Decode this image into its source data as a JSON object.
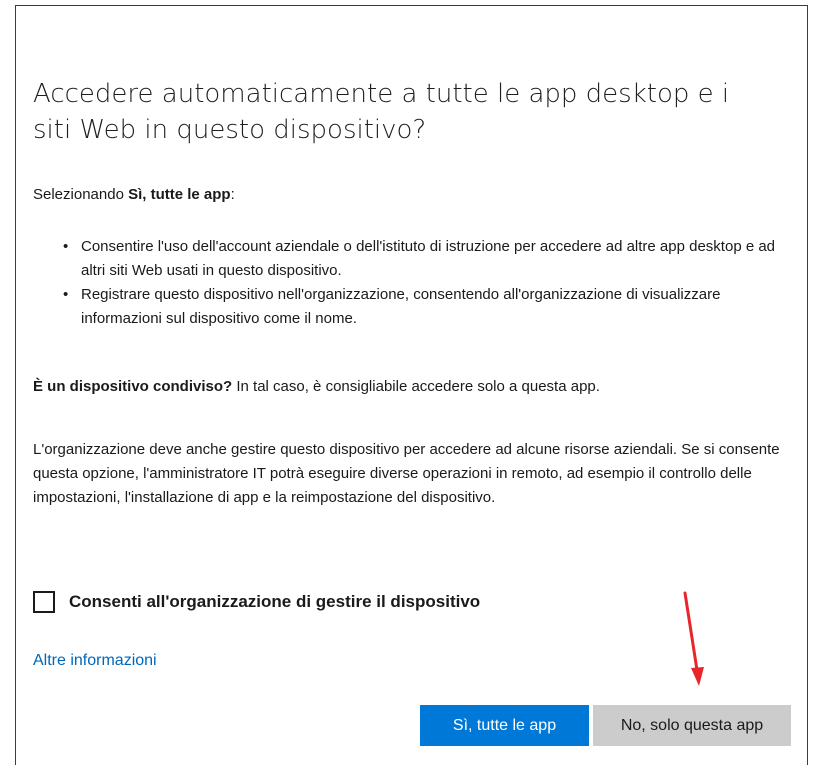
{
  "dialog": {
    "title": "Accedere automaticamente a tutte le app desktop e i siti Web in questo dispositivo?",
    "intro_prefix": "Selezionando ",
    "intro_bold": "Sì, tutte le app",
    "intro_suffix": ":",
    "bullets": [
      "Consentire l'uso dell'account aziendale o dell'istituto di istruzione per accedere ad altre app desktop e ad altri siti Web usati in questo dispositivo.",
      "Registrare questo dispositivo nell'organizzazione, consentendo all'organizzazione di visualizzare informazioni sul dispositivo come il nome."
    ],
    "shared_bold": "È un dispositivo condiviso?",
    "shared_text": " In tal caso, è consigliabile accedere solo a questa app.",
    "org_text": "L'organizzazione deve anche gestire questo dispositivo per accedere ad alcune risorse aziendali. Se si consente questa opzione, l'amministratore IT potrà eseguire diverse operazioni in remoto, ad esempio il controllo delle impostazioni, l'installazione di app e la reimpostazione del dispositivo.",
    "checkbox_label": "Consenti all'organizzazione di gestire il dispositivo",
    "checkbox_checked": false,
    "more_info_link": "Altre informazioni",
    "primary_button": "Sì, tutte le app",
    "secondary_button": "No, solo questa app"
  },
  "colors": {
    "accent": "#0078d7",
    "link": "#0067b8",
    "secondary_button": "#cccccc",
    "annotation_arrow": "#e8262a"
  }
}
